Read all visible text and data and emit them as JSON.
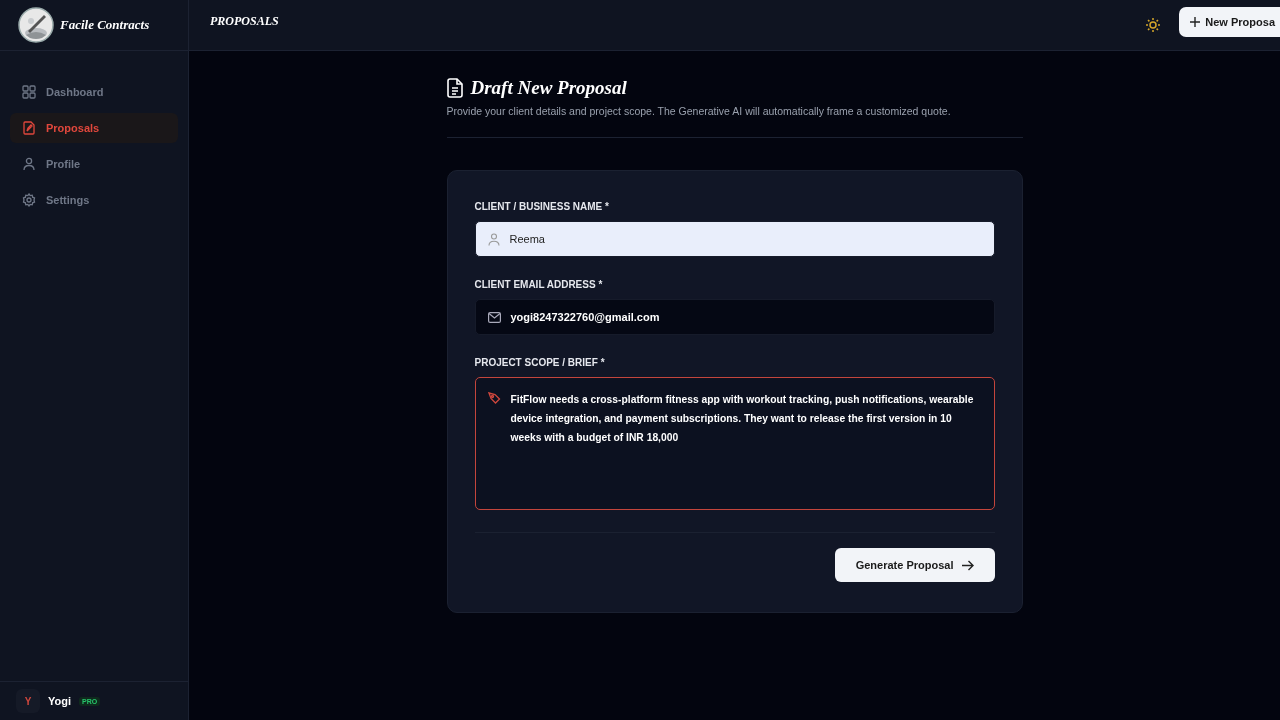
{
  "brand": {
    "name": "Facile Contracts"
  },
  "header": {
    "title": "PROPOSALS",
    "new_button": "New Proposa"
  },
  "sidebar": {
    "items": [
      {
        "label": "Dashboard",
        "kind": "dashboard",
        "selected": false
      },
      {
        "label": "Proposals",
        "kind": "proposals",
        "selected": true
      },
      {
        "label": "Profile",
        "kind": "profile",
        "selected": false
      },
      {
        "label": "Settings",
        "kind": "settings",
        "selected": false
      }
    ],
    "user": {
      "initial": "Y",
      "name": "Yogi",
      "badge": "PRO"
    }
  },
  "form": {
    "title": "Draft New Proposal",
    "subtitle": "Provide your client details and project scope. The Generative AI will automatically frame a customized quote.",
    "fields": [
      {
        "kind": "text",
        "label": "CLIENT / BUSINESS NAME *",
        "value": "Reema",
        "autofilled": true,
        "focused": false
      },
      {
        "kind": "email",
        "label": "CLIENT EMAIL ADDRESS *",
        "value": "yogi8247322760@gmail.com",
        "autofilled": false,
        "focused": false
      },
      {
        "kind": "textarea",
        "label": "PROJECT SCOPE / BRIEF *",
        "value": "FitFlow needs a cross-platform fitness app with workout tracking, push notifications, wearable device integration, and payment subscriptions. They want to release the first version in 10 weeks with a budget of INR 18,000",
        "autofilled": false,
        "focused": true
      }
    ],
    "submit": "Generate Proposal"
  }
}
